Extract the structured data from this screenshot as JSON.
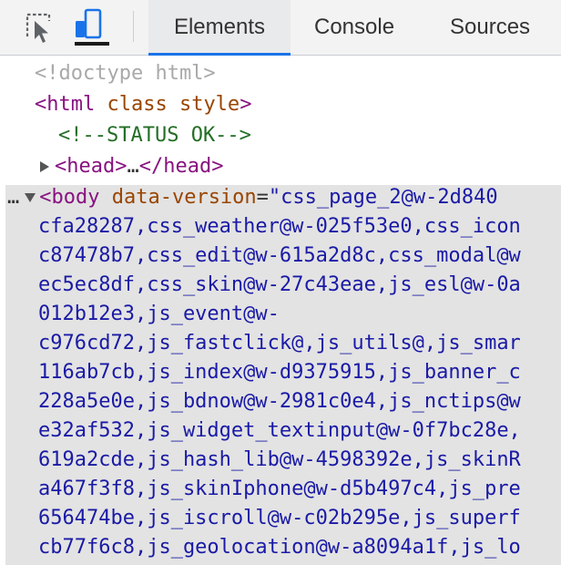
{
  "toolbar": {
    "inspect_icon": "element-picker-icon",
    "device_icon": "device-toolbar-icon",
    "tabs": [
      "Elements",
      "Console",
      "Sources"
    ]
  },
  "tree": {
    "doctype": "<!doctype html>",
    "html_tag_open": "<html",
    "html_attrs": " class style",
    "html_tag_close": ">",
    "comment": "<!--STATUS OK-->",
    "head_open": "<head>",
    "head_ellipsis": "…",
    "head_close": "</head>",
    "gutter_dots": "…",
    "body_tag_open": "<body",
    "body_attr_name": " data-version",
    "body_attr_eq": "=",
    "body_attr_first": "\"css_page_2@w-2d840",
    "body_attr_lines": [
      "cfa28287,css_weather@w-025f53e0,css_icon",
      "c87478b7,css_edit@w-615a2d8c,css_modal@w",
      "ec5ec8df,css_skin@w-27c43eae,js_esl@w-0a",
      "012b12e3,js_event@w-",
      "c976cd72,js_fastclick@,js_utils@,js_smar",
      "116ab7cb,js_index@w-d9375915,js_banner_c",
      "228a5e0e,js_bdnow@w-2981c0e4,js_nctips@w",
      "e32af532,js_widget_textinput@w-0f7bc28e,",
      "619a2cde,js_hash_lib@w-4598392e,js_skinR",
      "a467f3f8,js_skinIphone@w-d5b497c4,js_pre",
      "656474be,js_iscroll@w-c02b295e,js_superf",
      "cb77f6c8,js_geolocation@w-a8094a1f,js_lo"
    ]
  },
  "colors": {
    "tag": "#881280",
    "attr_name": "#994500",
    "attr_value": "#1a1aa6",
    "comment": "#236e25",
    "doctype": "#a9a9a9",
    "active_tab_indicator": "#1a73e8"
  }
}
